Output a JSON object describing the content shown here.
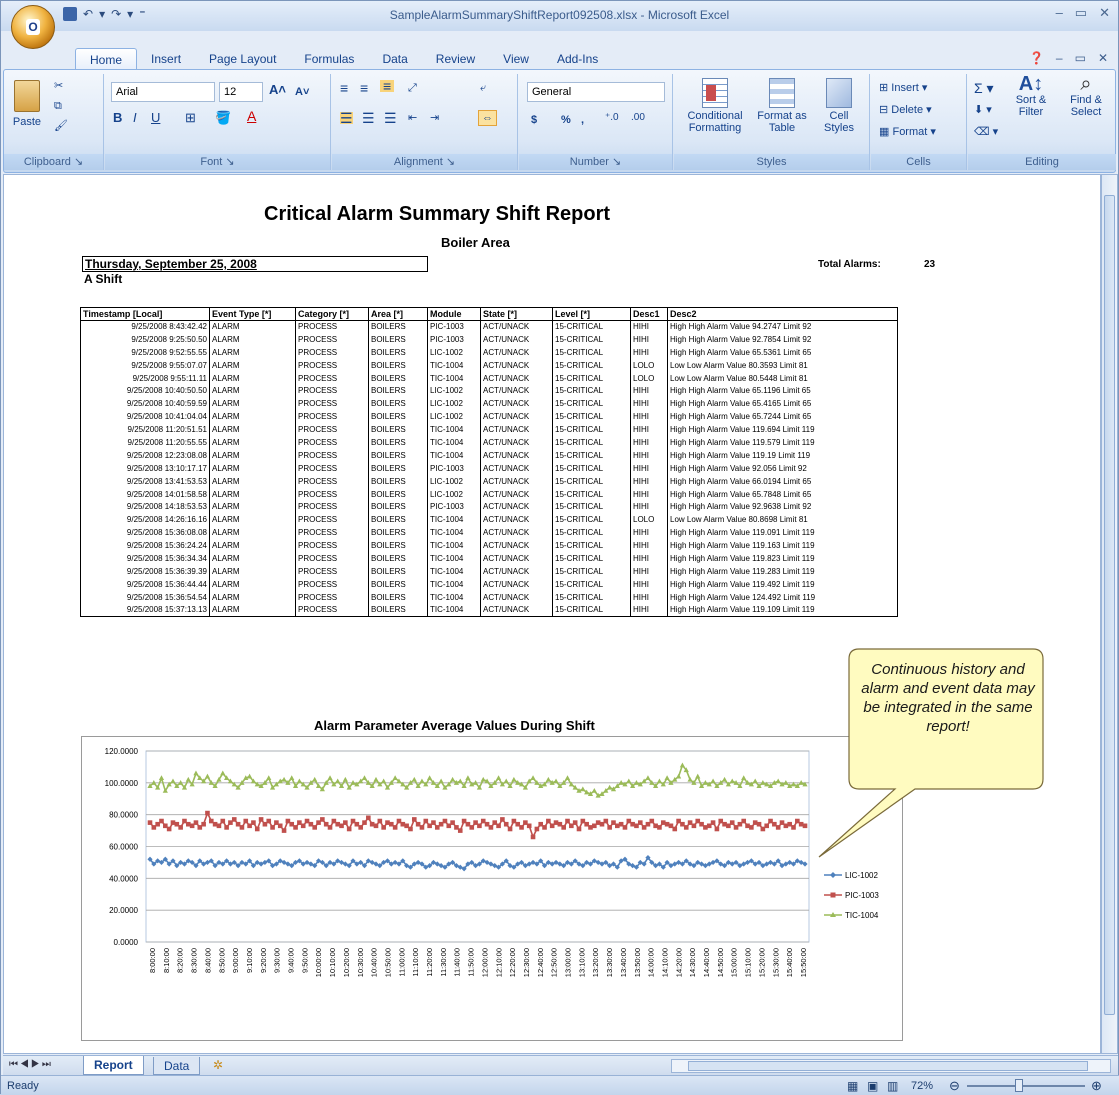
{
  "window": {
    "title": "SampleAlarmSummaryShiftReport092508.xlsx - Microsoft Excel",
    "office_button": "O"
  },
  "ribbon": {
    "tabs": [
      "Home",
      "Insert",
      "Page Layout",
      "Formulas",
      "Data",
      "Review",
      "View",
      "Add-Ins"
    ],
    "active_tab": "Home",
    "clipboard": {
      "label": "Clipboard",
      "paste": "Paste"
    },
    "font": {
      "label": "Font",
      "name": "Arial",
      "size": "12"
    },
    "alignment": {
      "label": "Alignment"
    },
    "number": {
      "label": "Number",
      "format": "General",
      "currency": "$",
      "percent": "%",
      "comma": ","
    },
    "styles": {
      "label": "Styles",
      "conditional": "Conditional Formatting",
      "format_table": "Format as Table",
      "cell_styles": "Cell Styles"
    },
    "cells": {
      "label": "Cells",
      "insert": "Insert",
      "delete": "Delete",
      "format": "Format"
    },
    "editing": {
      "label": "Editing",
      "sort": "Sort & Filter",
      "find": "Find & Select"
    }
  },
  "report": {
    "title": "Critical Alarm Summary Shift Report",
    "subtitle": "Boiler Area",
    "date": "Thursday, September 25, 2008",
    "shift": "A Shift",
    "total_label": "Total Alarms:",
    "total_value": "23",
    "columns": [
      "Timestamp [Local]",
      "Event Type [*]",
      "Category [*]",
      "Area [*]",
      "Module",
      "State [*]",
      "Level [*]",
      "Desc1",
      "Desc2"
    ],
    "rows": [
      [
        "9/25/2008 8:43:42.42",
        "ALARM",
        "PROCESS",
        "BOILERS",
        "PIC-1003",
        "ACT/UNACK",
        "15-CRITICAL",
        "HIHI",
        "High High Alarm Value 94.2747 Limit 92"
      ],
      [
        "9/25/2008 9:25:50.50",
        "ALARM",
        "PROCESS",
        "BOILERS",
        "PIC-1003",
        "ACT/UNACK",
        "15-CRITICAL",
        "HIHI",
        "High High Alarm Value 92.7854 Limit 92"
      ],
      [
        "9/25/2008 9:52:55.55",
        "ALARM",
        "PROCESS",
        "BOILERS",
        "LIC-1002",
        "ACT/UNACK",
        "15-CRITICAL",
        "HIHI",
        "High High Alarm Value 65.5361 Limit 65"
      ],
      [
        "9/25/2008 9:55:07.07",
        "ALARM",
        "PROCESS",
        "BOILERS",
        "TIC-1004",
        "ACT/UNACK",
        "15-CRITICAL",
        "LOLO",
        "Low Low Alarm Value 80.3593 Limit 81"
      ],
      [
        "9/25/2008 9:55:11.11",
        "ALARM",
        "PROCESS",
        "BOILERS",
        "TIC-1004",
        "ACT/UNACK",
        "15-CRITICAL",
        "LOLO",
        "Low Low Alarm Value 80.5448 Limit 81"
      ],
      [
        "9/25/2008 10:40:50.50",
        "ALARM",
        "PROCESS",
        "BOILERS",
        "LIC-1002",
        "ACT/UNACK",
        "15-CRITICAL",
        "HIHI",
        "High High Alarm Value 65.1196 Limit 65"
      ],
      [
        "9/25/2008 10:40:59.59",
        "ALARM",
        "PROCESS",
        "BOILERS",
        "LIC-1002",
        "ACT/UNACK",
        "15-CRITICAL",
        "HIHI",
        "High High Alarm Value 65.4165 Limit 65"
      ],
      [
        "9/25/2008 10:41:04.04",
        "ALARM",
        "PROCESS",
        "BOILERS",
        "LIC-1002",
        "ACT/UNACK",
        "15-CRITICAL",
        "HIHI",
        "High High Alarm Value 65.7244 Limit 65"
      ],
      [
        "9/25/2008 11:20:51.51",
        "ALARM",
        "PROCESS",
        "BOILERS",
        "TIC-1004",
        "ACT/UNACK",
        "15-CRITICAL",
        "HIHI",
        "High High Alarm Value 119.694 Limit 119"
      ],
      [
        "9/25/2008 11:20:55.55",
        "ALARM",
        "PROCESS",
        "BOILERS",
        "TIC-1004",
        "ACT/UNACK",
        "15-CRITICAL",
        "HIHI",
        "High High Alarm Value 119.579 Limit 119"
      ],
      [
        "9/25/2008 12:23:08.08",
        "ALARM",
        "PROCESS",
        "BOILERS",
        "TIC-1004",
        "ACT/UNACK",
        "15-CRITICAL",
        "HIHI",
        "High High Alarm Value 119.19 Limit 119"
      ],
      [
        "9/25/2008 13:10:17.17",
        "ALARM",
        "PROCESS",
        "BOILERS",
        "PIC-1003",
        "ACT/UNACK",
        "15-CRITICAL",
        "HIHI",
        "High High Alarm Value 92.056 Limit 92"
      ],
      [
        "9/25/2008 13:41:53.53",
        "ALARM",
        "PROCESS",
        "BOILERS",
        "LIC-1002",
        "ACT/UNACK",
        "15-CRITICAL",
        "HIHI",
        "High High Alarm Value 66.0194 Limit 65"
      ],
      [
        "9/25/2008 14:01:58.58",
        "ALARM",
        "PROCESS",
        "BOILERS",
        "LIC-1002",
        "ACT/UNACK",
        "15-CRITICAL",
        "HIHI",
        "High High Alarm Value 65.7848 Limit 65"
      ],
      [
        "9/25/2008 14:18:53.53",
        "ALARM",
        "PROCESS",
        "BOILERS",
        "PIC-1003",
        "ACT/UNACK",
        "15-CRITICAL",
        "HIHI",
        "High High Alarm Value 92.9638 Limit 92"
      ],
      [
        "9/25/2008 14:26:16.16",
        "ALARM",
        "PROCESS",
        "BOILERS",
        "TIC-1004",
        "ACT/UNACK",
        "15-CRITICAL",
        "LOLO",
        "Low Low Alarm Value 80.8698 Limit 81"
      ],
      [
        "9/25/2008 15:36:08.08",
        "ALARM",
        "PROCESS",
        "BOILERS",
        "TIC-1004",
        "ACT/UNACK",
        "15-CRITICAL",
        "HIHI",
        "High High Alarm Value 119.091 Limit 119"
      ],
      [
        "9/25/2008 15:36:24.24",
        "ALARM",
        "PROCESS",
        "BOILERS",
        "TIC-1004",
        "ACT/UNACK",
        "15-CRITICAL",
        "HIHI",
        "High High Alarm Value 119.163 Limit 119"
      ],
      [
        "9/25/2008 15:36:34.34",
        "ALARM",
        "PROCESS",
        "BOILERS",
        "TIC-1004",
        "ACT/UNACK",
        "15-CRITICAL",
        "HIHI",
        "High High Alarm Value 119.823 Limit 119"
      ],
      [
        "9/25/2008 15:36:39.39",
        "ALARM",
        "PROCESS",
        "BOILERS",
        "TIC-1004",
        "ACT/UNACK",
        "15-CRITICAL",
        "HIHI",
        "High High Alarm Value 119.283 Limit 119"
      ],
      [
        "9/25/2008 15:36:44.44",
        "ALARM",
        "PROCESS",
        "BOILERS",
        "TIC-1004",
        "ACT/UNACK",
        "15-CRITICAL",
        "HIHI",
        "High High Alarm Value 119.492 Limit 119"
      ],
      [
        "9/25/2008 15:36:54.54",
        "ALARM",
        "PROCESS",
        "BOILERS",
        "TIC-1004",
        "ACT/UNACK",
        "15-CRITICAL",
        "HIHI",
        "High High Alarm Value 124.492 Limit 119"
      ],
      [
        "9/25/2008 15:37:13.13",
        "ALARM",
        "PROCESS",
        "BOILERS",
        "TIC-1004",
        "ACT/UNACK",
        "15-CRITICAL",
        "HIHI",
        "High High Alarm Value 119.109 Limit 119"
      ]
    ]
  },
  "chart_data": {
    "type": "line",
    "title": "Alarm Parameter Average Values During Shift",
    "xlabel": "",
    "ylabel": "",
    "ylim": [
      0,
      120
    ],
    "ytick_labels": [
      "120.0000",
      "100.0000",
      "80.0000",
      "60.0000",
      "40.0000",
      "20.0000",
      "0.0000"
    ],
    "x_tick_labels": [
      "8:00:00",
      "8:10:00",
      "8:20:00",
      "8:30:00",
      "8:40:00",
      "8:50:00",
      "9:00:00",
      "9:10:00",
      "9:20:00",
      "9:30:00",
      "9:40:00",
      "9:50:00",
      "10:00:00",
      "10:10:00",
      "10:20:00",
      "10:30:00",
      "10:40:00",
      "10:50:00",
      "11:00:00",
      "11:10:00",
      "11:20:00",
      "11:30:00",
      "11:40:00",
      "11:50:00",
      "12:00:00",
      "12:10:00",
      "12:20:00",
      "12:30:00",
      "12:40:00",
      "12:50:00",
      "13:00:00",
      "13:10:00",
      "13:20:00",
      "13:30:00",
      "13:40:00",
      "13:50:00",
      "14:00:00",
      "14:10:00",
      "14:20:00",
      "14:30:00",
      "14:40:00",
      "14:50:00",
      "15:00:00",
      "15:10:00",
      "15:20:00",
      "15:30:00",
      "15:40:00",
      "15:50:00"
    ],
    "legend_position": "right",
    "grid": true,
    "series": [
      {
        "name": "LIC-1002",
        "color": "#4f81bd",
        "marker": "diamond",
        "values": [
          52,
          49,
          51,
          50,
          52,
          49,
          51,
          48,
          50,
          49,
          51,
          50,
          48,
          51,
          49,
          50,
          51,
          48,
          50,
          49,
          51,
          49,
          50,
          48,
          50,
          49,
          51,
          48,
          50,
          49,
          50,
          51,
          48,
          49,
          51,
          50,
          49,
          48,
          50,
          51,
          49,
          50,
          49,
          48,
          51,
          50,
          48,
          50,
          49,
          51,
          50,
          49,
          48,
          51,
          49,
          50,
          48,
          51,
          50,
          49,
          48,
          50,
          51,
          49,
          50,
          49,
          51,
          48,
          47,
          49,
          50,
          49,
          47,
          48,
          50,
          49,
          48,
          47,
          49,
          50,
          48,
          47,
          46,
          49,
          50,
          48,
          49,
          51,
          50,
          49,
          48,
          47,
          49,
          51,
          48,
          47,
          49,
          50,
          48,
          49,
          50,
          49,
          51,
          48,
          50,
          49,
          50,
          49,
          48,
          50,
          49,
          51,
          49,
          48,
          50,
          49,
          51,
          50,
          49,
          50,
          48,
          49,
          47,
          51,
          52,
          49,
          48,
          47,
          50,
          49,
          53,
          50,
          48,
          49,
          47,
          50,
          48,
          49,
          50,
          49,
          51,
          49,
          48,
          50,
          49,
          48,
          49,
          50,
          51,
          49,
          48,
          50,
          49,
          50,
          48,
          49,
          50,
          51,
          49,
          50,
          48,
          49,
          50,
          49,
          51,
          48,
          49,
          50,
          49,
          51,
          50,
          49
        ]
      },
      {
        "name": "PIC-1003",
        "color": "#c0504d",
        "marker": "square",
        "values": [
          75,
          72,
          74,
          76,
          73,
          71,
          75,
          74,
          72,
          76,
          74,
          73,
          75,
          72,
          74,
          81,
          76,
          74,
          73,
          76,
          72,
          75,
          77,
          74,
          72,
          76,
          73,
          75,
          71,
          77,
          74,
          76,
          72,
          75,
          73,
          70,
          76,
          74,
          72,
          75,
          73,
          76,
          74,
          72,
          75,
          77,
          74,
          72,
          76,
          74,
          73,
          75,
          71,
          76,
          74,
          72,
          75,
          78,
          74,
          73,
          76,
          72,
          75,
          74,
          72,
          76,
          74,
          73,
          71,
          77,
          74,
          72,
          76,
          73,
          75,
          72,
          74,
          76,
          73,
          75,
          72,
          70,
          76,
          74,
          72,
          75,
          73,
          76,
          74,
          72,
          75,
          73,
          77,
          74,
          71,
          76,
          74,
          72,
          75,
          73,
          66,
          71,
          74,
          72,
          76,
          73,
          75,
          74,
          72,
          76,
          73,
          75,
          71,
          76,
          74,
          72,
          73,
          75,
          74,
          76,
          72,
          75,
          73,
          74,
          72,
          76,
          74,
          73,
          75,
          72,
          74,
          76,
          73,
          72,
          75,
          74,
          73,
          71,
          76,
          74,
          72,
          75,
          73,
          76,
          74,
          72,
          73,
          75,
          71,
          76,
          74,
          73,
          75,
          72,
          74,
          76,
          73,
          72,
          75,
          74,
          71,
          73,
          76,
          74,
          72,
          75,
          73,
          74,
          72,
          76,
          74,
          73
        ]
      },
      {
        "name": "TIC-1004",
        "color": "#9bbb59",
        "marker": "triangle",
        "values": [
          98,
          100,
          97,
          103,
          95,
          99,
          101,
          98,
          100,
          97,
          102,
          99,
          106,
          103,
          101,
          104,
          100,
          98,
          102,
          106,
          103,
          101,
          99,
          97,
          100,
          103,
          104,
          101,
          99,
          98,
          100,
          103,
          97,
          99,
          101,
          102,
          100,
          103,
          98,
          101,
          99,
          97,
          100,
          102,
          98,
          96,
          100,
          103,
          99,
          101,
          98,
          102,
          97,
          100,
          99,
          101,
          103,
          100,
          98,
          102,
          99,
          101,
          97,
          100,
          103,
          101,
          99,
          97,
          100,
          102,
          98,
          101,
          99,
          103,
          100,
          98,
          101,
          97,
          99,
          102,
          100,
          101,
          98,
          103,
          99,
          100,
          97,
          102,
          101,
          98,
          100,
          103,
          99,
          101,
          98,
          102,
          100,
          99,
          97,
          101,
          103,
          100,
          98,
          99,
          102,
          100,
          101,
          98,
          100,
          103,
          99,
          97,
          95,
          96,
          94,
          93,
          95,
          92,
          93,
          95,
          97,
          96,
          98,
          100,
          99,
          101,
          98,
          100,
          99,
          101,
          103,
          100,
          98,
          101,
          99,
          103,
          100,
          102,
          104,
          111,
          108,
          102,
          100,
          104,
          98,
          100,
          99,
          101,
          98,
          100,
          102,
          99,
          101,
          100,
          98,
          103,
          100,
          99,
          101,
          98,
          100,
          99,
          98,
          100,
          101,
          99,
          100,
          98,
          99,
          98,
          100,
          99
        ]
      }
    ]
  },
  "callout": {
    "text": "Continuous history and alarm and event data may be integrated in the same report!"
  },
  "sheet_tabs": [
    "Report",
    "Data"
  ],
  "status": {
    "ready": "Ready",
    "zoom": "72%"
  }
}
